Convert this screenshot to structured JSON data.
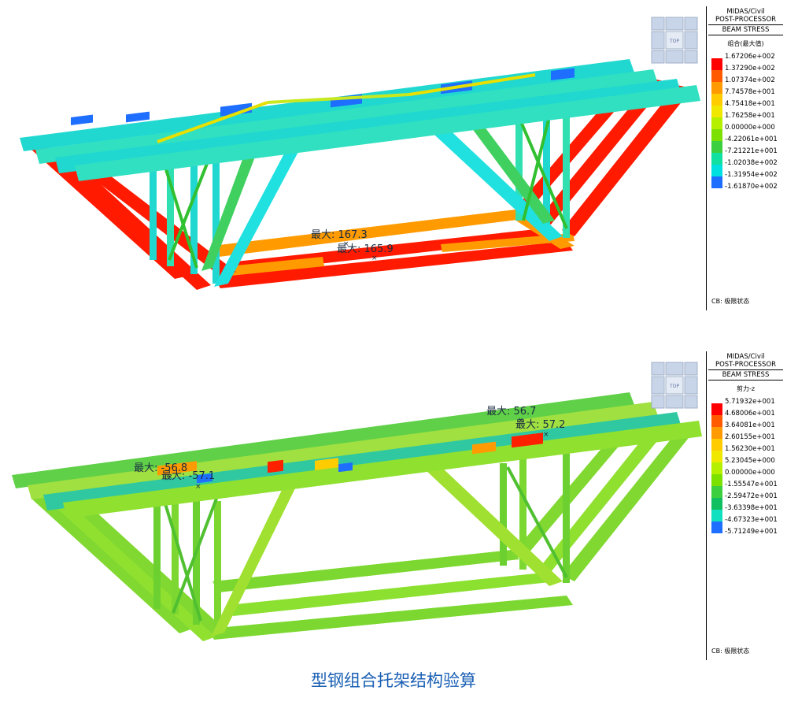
{
  "panels": [
    {
      "id": "top",
      "legend": {
        "header_line1": "MIDAS/Civil",
        "header_line2": "POST-PROCESSOR",
        "header_line3": "BEAM STRESS",
        "component": "组合(最大值)",
        "values": [
          "1.67206e+002",
          "1.37290e+002",
          "1.07374e+002",
          "7.74578e+001",
          "4.75418e+001",
          "1.76258e+001",
          "0.00000e+000",
          "-4.22061e+001",
          "-7.21221e+001",
          "-1.02038e+002",
          "-1.31954e+002",
          "-1.61870e+002"
        ],
        "colors": [
          "#ff0000",
          "#ff5a00",
          "#ff9b00",
          "#ffcc00",
          "#f0e800",
          "#b4f000",
          "#7ce000",
          "#3cd040",
          "#10e0a0",
          "#00e0e0",
          "#1e6eff"
        ],
        "combination": "CB: 极限状态"
      },
      "annotations": [
        {
          "text": "最大: 167.3"
        },
        {
          "text": "最大: 165.9"
        }
      ]
    },
    {
      "id": "bottom",
      "legend": {
        "header_line1": "MIDAS/Civil",
        "header_line2": "POST-PROCESSOR",
        "header_line3": "BEAM STRESS",
        "component": "剪力-z",
        "values": [
          "5.71932e+001",
          "4.68006e+001",
          "3.64081e+001",
          "2.60155e+001",
          "1.56230e+001",
          "5.23045e+000",
          "0.00000e+000",
          "-1.55547e+001",
          "-2.59472e+001",
          "-3.63398e+001",
          "-4.67323e+001",
          "-5.71249e+001"
        ],
        "colors": [
          "#ff0000",
          "#ff5a00",
          "#ff9b00",
          "#ffcc00",
          "#f0e800",
          "#b4f000",
          "#7ce000",
          "#3cd040",
          "#10c060",
          "#10e0c0",
          "#1e6eff"
        ],
        "combination": "CB: 极限状态"
      },
      "annotations": [
        {
          "text": "最大: 56.7"
        },
        {
          "text": "最大: 57.2"
        },
        {
          "text": "最大: -56.8"
        },
        {
          "text": "最大: -57.1"
        }
      ]
    }
  ],
  "viewcube": {
    "label": "TOP"
  },
  "caption": "型钢组合托架结构验算"
}
